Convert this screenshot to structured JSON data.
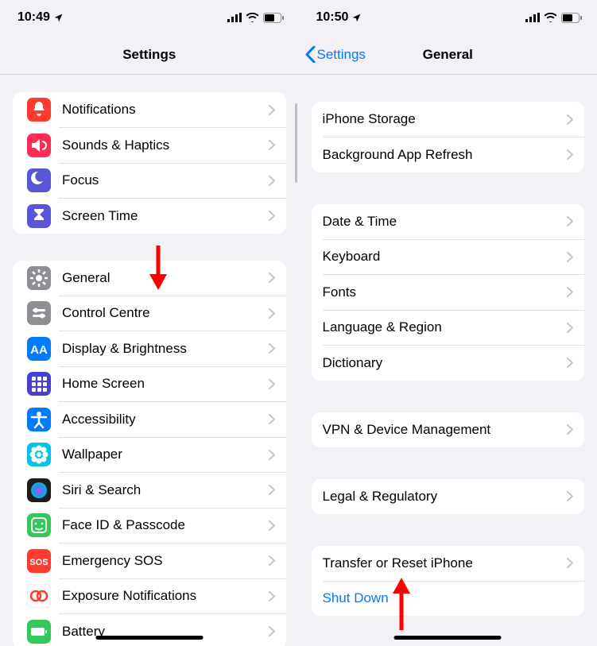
{
  "left": {
    "status_time": "10:49",
    "title": "Settings",
    "group1": [
      {
        "label": "Notifications",
        "icon": "bell",
        "bg": "#ff3b30"
      },
      {
        "label": "Sounds & Haptics",
        "icon": "speaker",
        "bg": "#ff2d55"
      },
      {
        "label": "Focus",
        "icon": "moon",
        "bg": "#5856d6"
      },
      {
        "label": "Screen Time",
        "icon": "hourglass",
        "bg": "#5856d6"
      }
    ],
    "group2": [
      {
        "label": "General",
        "icon": "gear",
        "bg": "#8e8e93"
      },
      {
        "label": "Control Centre",
        "icon": "sliders",
        "bg": "#8e8e93"
      },
      {
        "label": "Display & Brightness",
        "icon": "aa",
        "bg": "#007aff"
      },
      {
        "label": "Home Screen",
        "icon": "grid",
        "bg": "#4640d6"
      },
      {
        "label": "Accessibility",
        "icon": "access",
        "bg": "#007aff"
      },
      {
        "label": "Wallpaper",
        "icon": "flower",
        "bg": "#00c3e6"
      },
      {
        "label": "Siri & Search",
        "icon": "siri",
        "bg": "#1c1c1e"
      },
      {
        "label": "Face ID & Passcode",
        "icon": "face",
        "bg": "#34c759"
      },
      {
        "label": "Emergency SOS",
        "icon": "sos",
        "bg": "#ff3b30"
      },
      {
        "label": "Exposure Notifications",
        "icon": "expo",
        "bg": "#ffffff"
      },
      {
        "label": "Battery",
        "icon": "battery",
        "bg": "#34c759"
      }
    ]
  },
  "right": {
    "status_time": "10:50",
    "back_label": "Settings",
    "title": "General",
    "group1": [
      {
        "label": "iPhone Storage"
      },
      {
        "label": "Background App Refresh"
      }
    ],
    "group2": [
      {
        "label": "Date & Time"
      },
      {
        "label": "Keyboard"
      },
      {
        "label": "Fonts"
      },
      {
        "label": "Language & Region"
      },
      {
        "label": "Dictionary"
      }
    ],
    "group3": [
      {
        "label": "VPN & Device Management"
      }
    ],
    "group4": [
      {
        "label": "Legal & Regulatory"
      }
    ],
    "group5": [
      {
        "label": "Transfer or Reset iPhone",
        "chevron": true
      },
      {
        "label": "Shut Down",
        "link": true
      }
    ]
  }
}
